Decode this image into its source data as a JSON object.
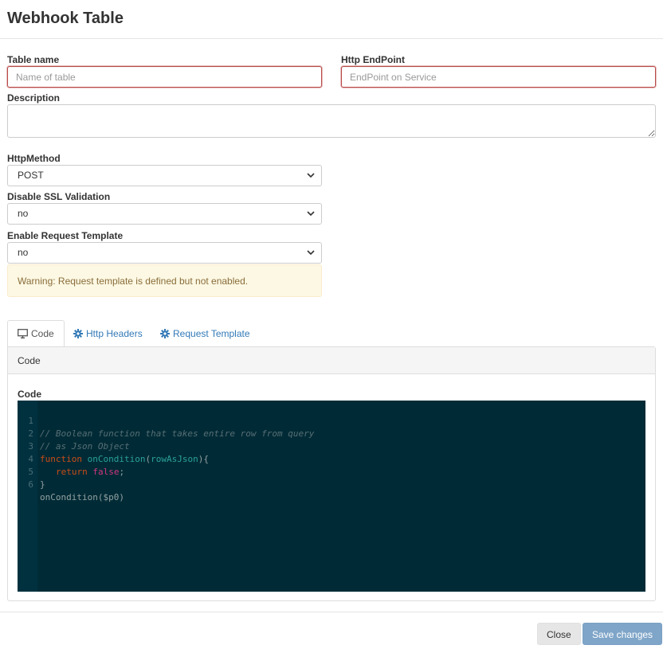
{
  "modal": {
    "title": "Webhook Table"
  },
  "form": {
    "table_name": {
      "label": "Table name",
      "placeholder": "Name of table"
    },
    "http_endpoint": {
      "label": "Http EndPoint",
      "placeholder": "EndPoint on Service"
    },
    "description": {
      "label": "Description"
    },
    "http_method": {
      "label": "HttpMethod",
      "value": "POST"
    },
    "disable_ssl": {
      "label": "Disable SSL Validation",
      "value": "no"
    },
    "enable_request_template": {
      "label": "Enable Request Template",
      "value": "no"
    },
    "warning": "Warning: Request template is defined but not enabled."
  },
  "tabs": [
    {
      "label": "Code",
      "icon": "monitor-icon",
      "active": true
    },
    {
      "label": "Http Headers",
      "icon": "gear-icon",
      "active": false
    },
    {
      "label": "Request Template",
      "icon": "gear-icon",
      "active": false
    }
  ],
  "panel": {
    "heading": "Code",
    "code_label": "Code",
    "code_lines": [
      {
        "n": "1",
        "text": "// Boolean function that takes entire row from query"
      },
      {
        "n": "2",
        "text": "// as Json Object"
      },
      {
        "n": "3",
        "kw": "function",
        "fn": "onCondition",
        "args": "rowAsJson",
        "rest": "){"
      },
      {
        "n": "4",
        "kw": "return",
        "bool": "false",
        "rest": ";"
      },
      {
        "n": "5",
        "text": "}"
      },
      {
        "n": "6",
        "text": "onCondition($p0)"
      }
    ]
  },
  "footer": {
    "close_label": "Close",
    "save_label": "Save changes"
  },
  "colors": {
    "link": "#337ab7",
    "error_border": "#b94a48",
    "warning_bg": "#fcf8e3",
    "editor_bg": "#002b36",
    "primary_btn": "#7fa5c8"
  }
}
